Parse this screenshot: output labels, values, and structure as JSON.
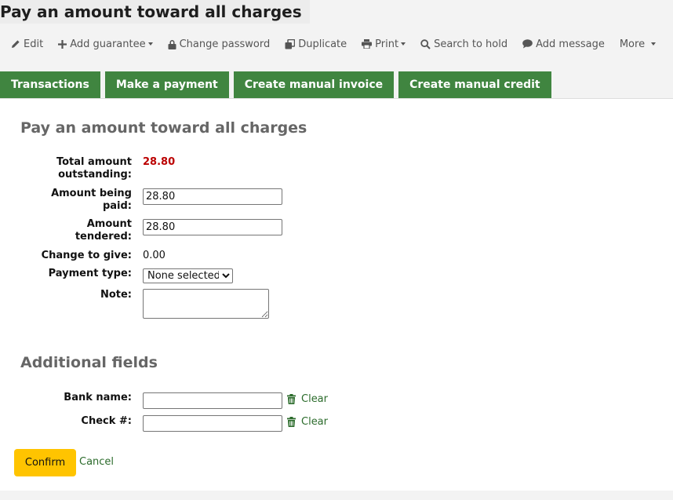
{
  "page_title": "Pay an amount toward all charges",
  "toolbar": {
    "edit": "Edit",
    "add_guarantee": "Add guarantee",
    "change_password": "Change password",
    "duplicate": "Duplicate",
    "print": "Print",
    "search_to_hold": "Search to hold",
    "add_message": "Add message",
    "more": "More"
  },
  "tabs": [
    "Transactions",
    "Make a payment",
    "Create manual invoice",
    "Create manual credit"
  ],
  "form": {
    "heading": "Pay an amount toward all charges",
    "total_outstanding_label_1": "Total amount",
    "total_outstanding_label_2": "outstanding:",
    "total_outstanding_value": "28.80",
    "amount_paid_label_1": "Amount being",
    "amount_paid_label_2": "paid:",
    "amount_paid_value": "28.80",
    "amount_tendered_label_1": "Amount",
    "amount_tendered_label_2": "tendered:",
    "amount_tendered_value": "28.80",
    "change_label": "Change to give:",
    "change_value": "0.00",
    "payment_type_label": "Payment type:",
    "payment_type_selected": "None selected",
    "note_label": "Note:"
  },
  "additional": {
    "heading": "Additional fields",
    "bank_name_label": "Bank name:",
    "check_label": "Check #:",
    "clear_label": "Clear"
  },
  "actions": {
    "confirm": "Confirm",
    "cancel": "Cancel"
  },
  "colors": {
    "tab_green": "#408540",
    "outstanding_red": "#bb0000",
    "confirm_yellow": "#ffc400",
    "link_green": "#2b6b2b"
  }
}
